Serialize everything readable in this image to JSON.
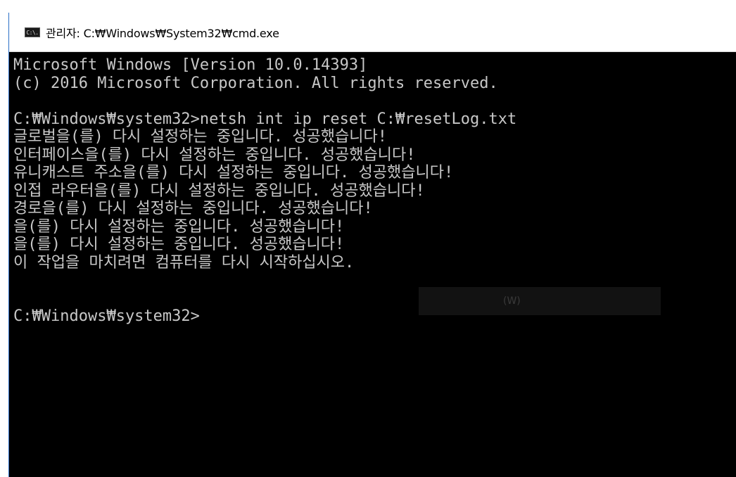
{
  "window": {
    "title": "관리자: C:₩Windows₩System32₩cmd.exe",
    "icon_label": "C:\\."
  },
  "console": {
    "lines": [
      "Microsoft Windows [Version 10.0.14393]",
      "(c) 2016 Microsoft Corporation. All rights reserved.",
      "",
      "C:₩Windows₩system32>netsh int ip reset C:₩resetLog.txt",
      "글로벌을(를) 다시 설정하는 중입니다. 성공했습니다!",
      "인터페이스을(를) 다시 설정하는 중입니다. 성공했습니다!",
      "유니캐스트 주소을(를) 다시 설정하는 중입니다. 성공했습니다!",
      "인접 라우터을(를) 다시 설정하는 중입니다. 성공했습니다!",
      "경로을(를) 다시 설정하는 중입니다. 성공했습니다!",
      "을(를) 다시 설정하는 중입니다. 성공했습니다!",
      "을(를) 다시 설정하는 중입니다. 성공했습니다!",
      "이 작업을 마치려면 컴퓨터를 다시 시작하십시오.",
      "",
      "",
      "C:₩Windows₩system32>"
    ],
    "ghost_text": "(W)"
  },
  "colors": {
    "console_bg": "#000000",
    "console_text": "#c8c8c8",
    "titlebar_bg": "#ffffff",
    "border_accent": "#2b6fc6"
  }
}
